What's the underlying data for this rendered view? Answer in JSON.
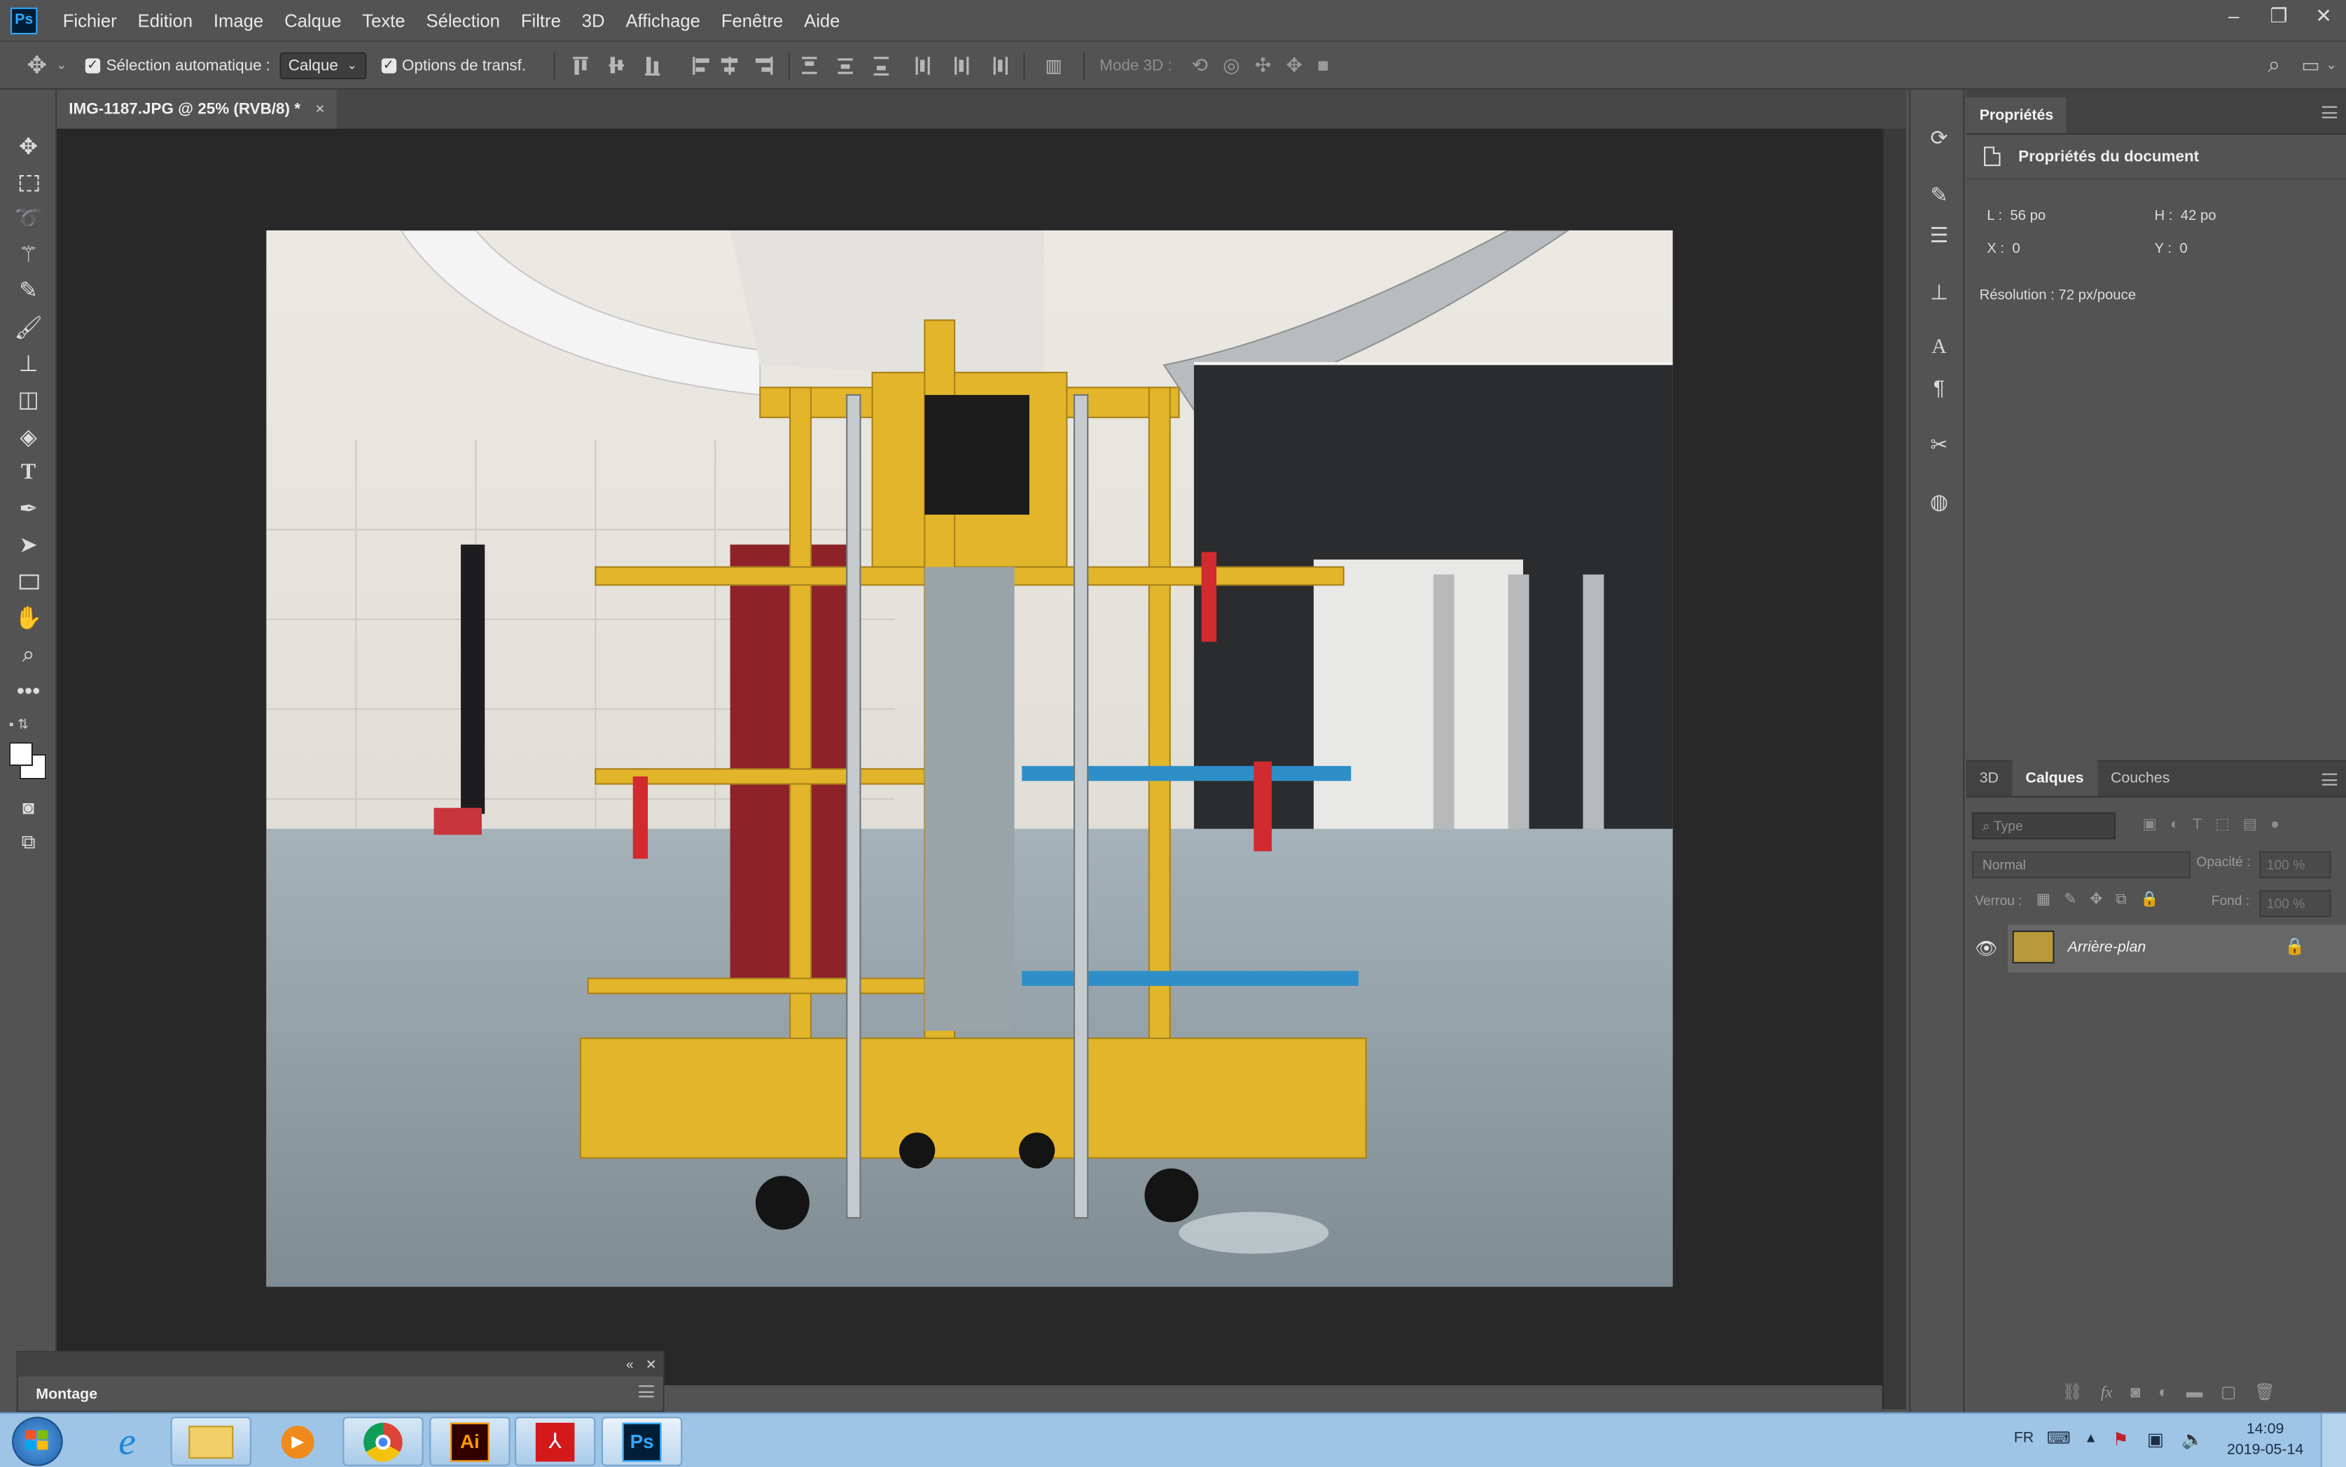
{
  "app": {
    "logo_text": "Ps",
    "brand_color": "#31a8ff"
  },
  "menubar": {
    "items": [
      "Fichier",
      "Edition",
      "Image",
      "Calque",
      "Texte",
      "Sélection",
      "Filtre",
      "3D",
      "Affichage",
      "Fenêtre",
      "Aide"
    ]
  },
  "window_controls": {
    "minimize": "‒",
    "restore": "❐",
    "close": "✕"
  },
  "options_bar": {
    "auto_select_label": "Sélection automatique :",
    "auto_select_checked": true,
    "auto_select_value": "Calque",
    "transform_label": "Options de transf.",
    "transform_checked": true,
    "mode3d_label": "Mode 3D :"
  },
  "document": {
    "tab_title": "IMG-1187.JPG @ 25% (RVB/8) *",
    "close_glyph": "×"
  },
  "tools": [
    "move-tool",
    "marquee-tool",
    "lasso-tool",
    "magic-wand-tool",
    "eyedropper-tool",
    "brush-tool",
    "stamp-tool",
    "eraser-tool",
    "paint-bucket-tool",
    "type-tool",
    "pen-tool",
    "path-selection-tool",
    "rectangle-tool",
    "hand-tool",
    "zoom-tool",
    "more-tools"
  ],
  "montage_panel": {
    "tab": "Montage"
  },
  "properties_panel": {
    "tab": "Propriétés",
    "subtitle": "Propriétés du document",
    "width_label": "L :",
    "width_value": "56 po",
    "height_label": "H :",
    "height_value": "42 po",
    "x_label": "X :",
    "x_value": "0",
    "y_label": "Y :",
    "y_value": "0",
    "resolution": "Résolution : 72 px/pouce"
  },
  "layers_panel": {
    "tabs": [
      "3D",
      "Calques",
      "Couches"
    ],
    "active_tab": "Calques",
    "filter_placeholder": "Type",
    "blend_mode": "Normal",
    "opacity_label": "Opacité :",
    "opacity_value": "100 %",
    "lock_label": "Verrou :",
    "fill_label": "Fond :",
    "fill_value": "100 %",
    "layers": [
      {
        "name": "Arrière-plan",
        "visible": true,
        "locked": true
      }
    ]
  },
  "taskbar": {
    "apps": [
      "windows-start",
      "internet-explorer",
      "file-explorer",
      "media-player",
      "chrome",
      "illustrator",
      "acrobat",
      "photoshop"
    ],
    "illustrator_label": "Ai",
    "photoshop_label": "Ps",
    "language": "FR",
    "time": "14:09",
    "date": "2019-05-14"
  }
}
